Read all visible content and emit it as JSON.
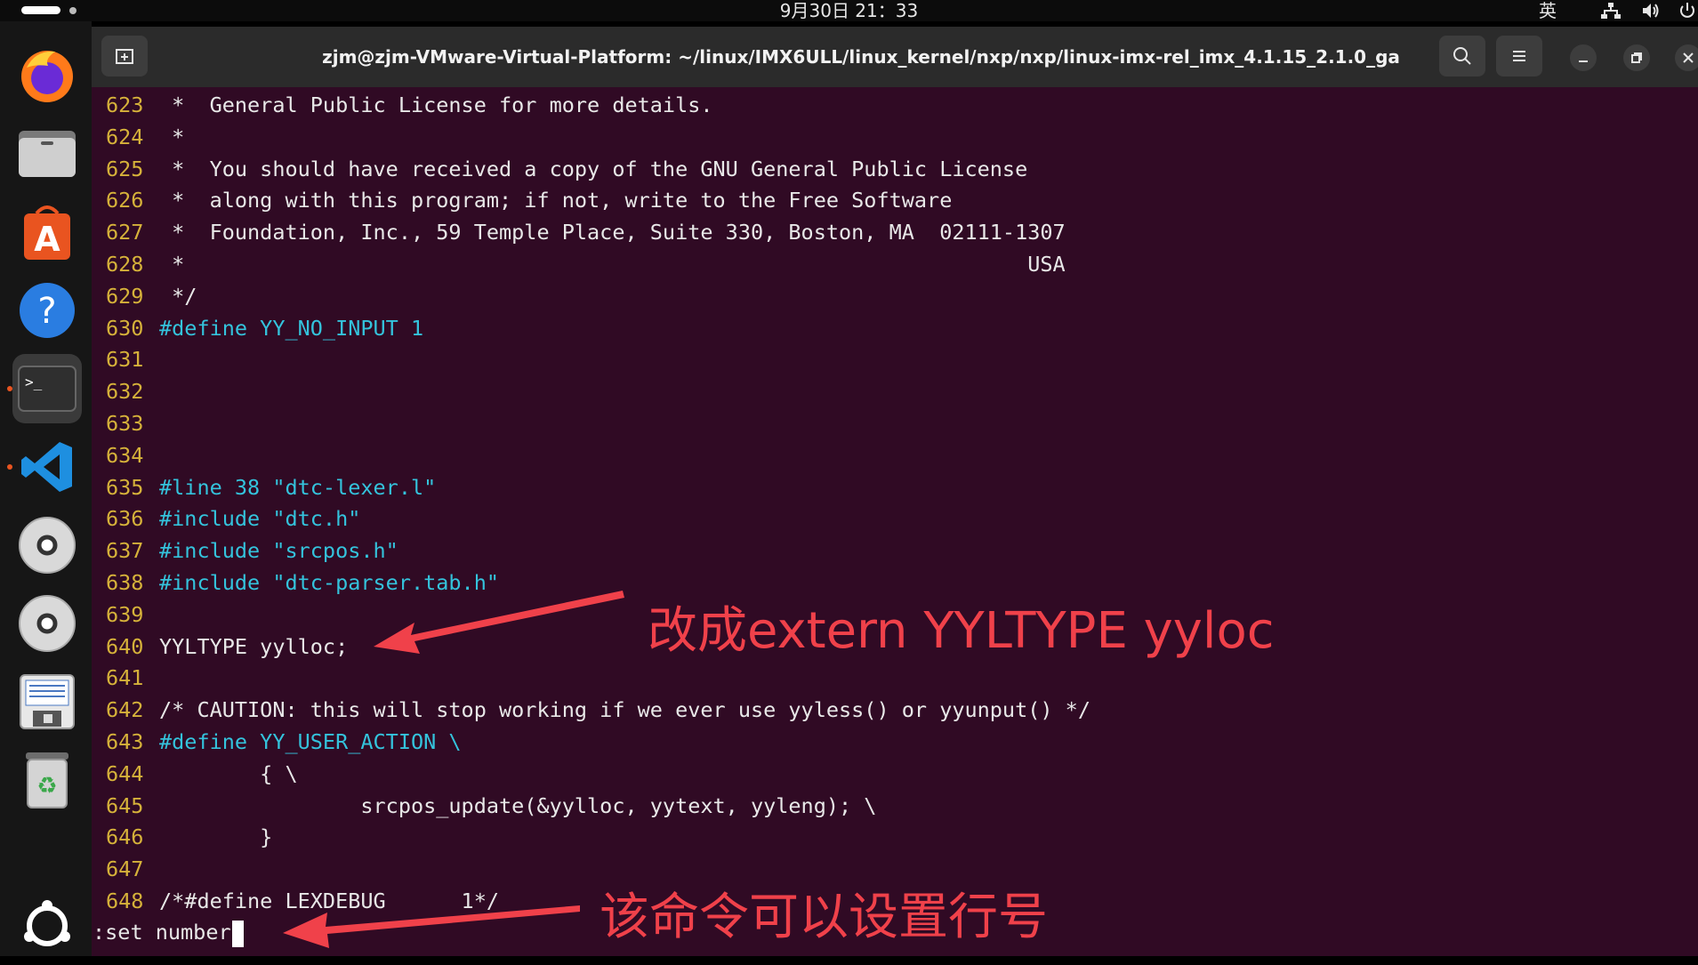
{
  "system_bar": {
    "clock": "9月30日 21：33",
    "input_method": "英"
  },
  "dock": {
    "items": [
      {
        "name": "firefox-icon"
      },
      {
        "name": "files-icon"
      },
      {
        "name": "app-center-icon"
      },
      {
        "name": "help-icon"
      },
      {
        "name": "terminal-icon",
        "active": true
      },
      {
        "name": "vscode-icon"
      },
      {
        "name": "disc-icon"
      },
      {
        "name": "disc-icon"
      },
      {
        "name": "document-viewer-icon"
      },
      {
        "name": "trash-icon"
      },
      {
        "name": "ubuntu-logo-icon"
      }
    ]
  },
  "terminal": {
    "title": "zjm@zjm-VMware-Virtual-Platform: ~/linux/IMX6ULL/linux_kernel/nxp/nxp/linux-imx-rel_imx_4.1.15_2.1.0_ga",
    "lines": [
      {
        "n": "623",
        "text": " *  General Public License for more details.",
        "style": "cmt"
      },
      {
        "n": "624",
        "text": " *",
        "style": "cmt"
      },
      {
        "n": "625",
        "text": " *  You should have received a copy of the GNU General Public License",
        "style": "cmt"
      },
      {
        "n": "626",
        "text": " *  along with this program; if not, write to the Free Software",
        "style": "cmt"
      },
      {
        "n": "627",
        "text": " *  Foundation, Inc., 59 Temple Place, Suite 330, Boston, MA  02111-1307",
        "style": "cmt"
      },
      {
        "n": "628",
        "text": " *                                                                   USA",
        "style": "cmt"
      },
      {
        "n": "629",
        "text": " */",
        "style": "cmt"
      },
      {
        "n": "630",
        "text": "#define YY_NO_INPUT 1",
        "style": "pp"
      },
      {
        "n": "631",
        "text": "",
        "style": ""
      },
      {
        "n": "632",
        "text": "",
        "style": ""
      },
      {
        "n": "633",
        "text": "",
        "style": ""
      },
      {
        "n": "634",
        "text": "",
        "style": ""
      },
      {
        "n": "635",
        "text": "#line 38 \"dtc-lexer.l\"",
        "style": "pp"
      },
      {
        "n": "636",
        "text": "#include \"dtc.h\"",
        "style": "pp"
      },
      {
        "n": "637",
        "text": "#include \"srcpos.h\"",
        "style": "pp"
      },
      {
        "n": "638",
        "text": "#include \"dtc-parser.tab.h\"",
        "style": "pp"
      },
      {
        "n": "639",
        "text": "",
        "style": ""
      },
      {
        "n": "640",
        "text": "YYLTYPE yylloc;",
        "style": ""
      },
      {
        "n": "641",
        "text": "",
        "style": ""
      },
      {
        "n": "642",
        "text": "/* CAUTION: this will stop working if we ever use yyless() or yyunput() */",
        "style": "cmt"
      },
      {
        "n": "643",
        "text": "#define YY_USER_ACTION \\",
        "style": "pp"
      },
      {
        "n": "644",
        "text": "        { \\",
        "style": ""
      },
      {
        "n": "645",
        "text": "                srcpos_update(&yylloc, yytext, yyleng); \\",
        "style": ""
      },
      {
        "n": "646",
        "text": "        }",
        "style": ""
      },
      {
        "n": "647",
        "text": "",
        "style": ""
      },
      {
        "n": "648",
        "text": "/*#define LEXDEBUG      1*/",
        "style": "cmt"
      }
    ],
    "command": ":set number"
  },
  "annotations": {
    "top": "改成extern YYLTYPE yyloc",
    "bottom": "该命令可以设置行号"
  },
  "colors": {
    "terminal_bg": "#300a24",
    "line_number": "#d6b23a",
    "preprocessor": "#34c3dc",
    "annotation": "#f0414a"
  }
}
